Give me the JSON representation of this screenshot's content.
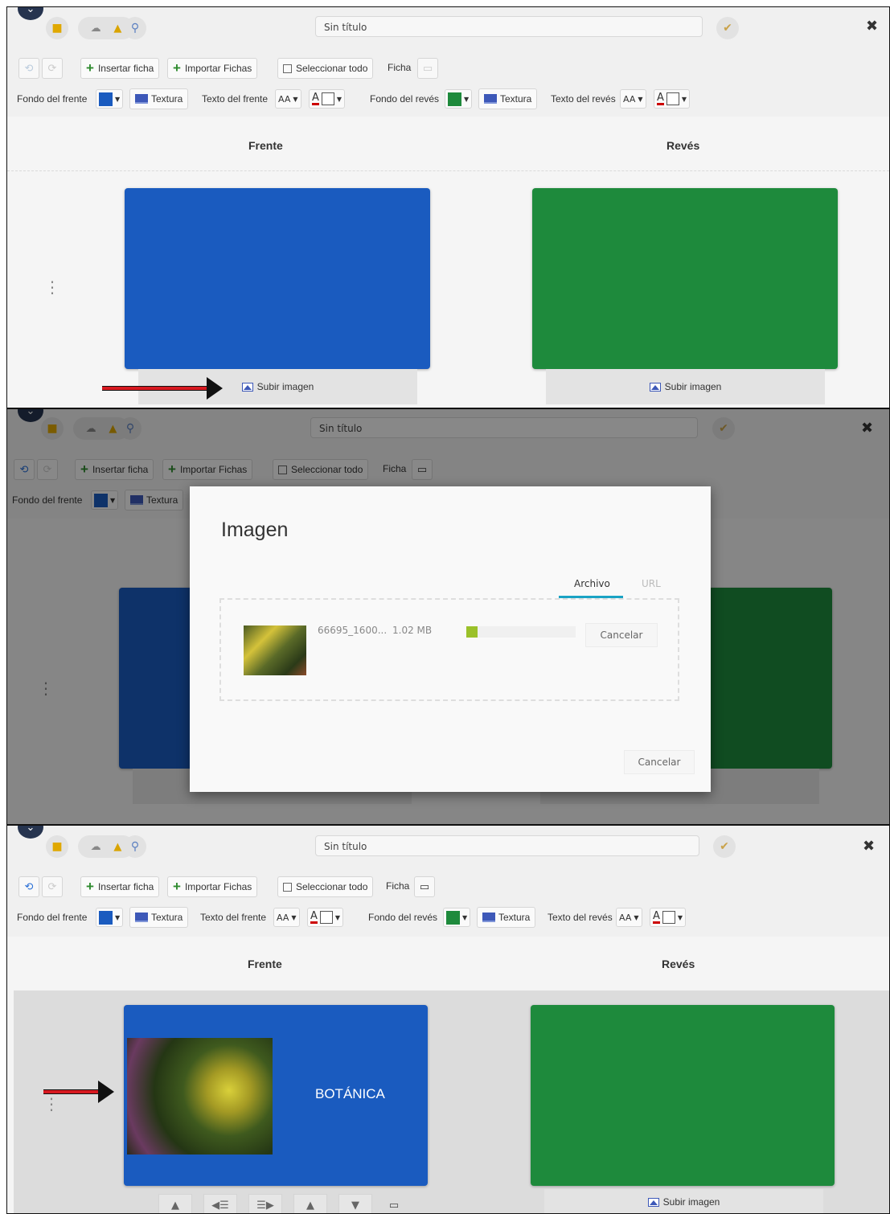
{
  "window": {
    "title_value": "Sin título",
    "undo_icon": "undo-icon",
    "redo_icon": "redo-icon"
  },
  "toolbar": {
    "insert_card": "Insertar ficha",
    "import_cards": "Importar Fichas",
    "select_all": "Seleccionar todo",
    "card_label": "Ficha",
    "front_bg": "Fondo del frente",
    "texture": "Textura",
    "front_text": "Texto del frente",
    "back_bg": "Fondo del revés",
    "back_text": "Texto del revés",
    "font_size_glyph": "AA",
    "font_color_glyph": "A"
  },
  "columns": {
    "front": "Frente",
    "back": "Revés"
  },
  "card": {
    "upload_image": "Subir imagen",
    "front_color": "#1a5bbf",
    "back_color": "#1e8a3c",
    "front_text": "BOTÁNICA"
  },
  "dialog": {
    "title": "Imagen",
    "tab_file": "Archivo",
    "tab_url": "URL",
    "file_name": "66695_1600...",
    "file_size": "1.02 MB",
    "progress": 0.03,
    "cancel_item": "Cancelar",
    "cancel": "Cancelar",
    "accent": "#1aa3c4"
  },
  "colors": {
    "front_swatch": "#1a5bbf",
    "back_swatch": "#1e8a3c",
    "arrow": "#d71920"
  }
}
